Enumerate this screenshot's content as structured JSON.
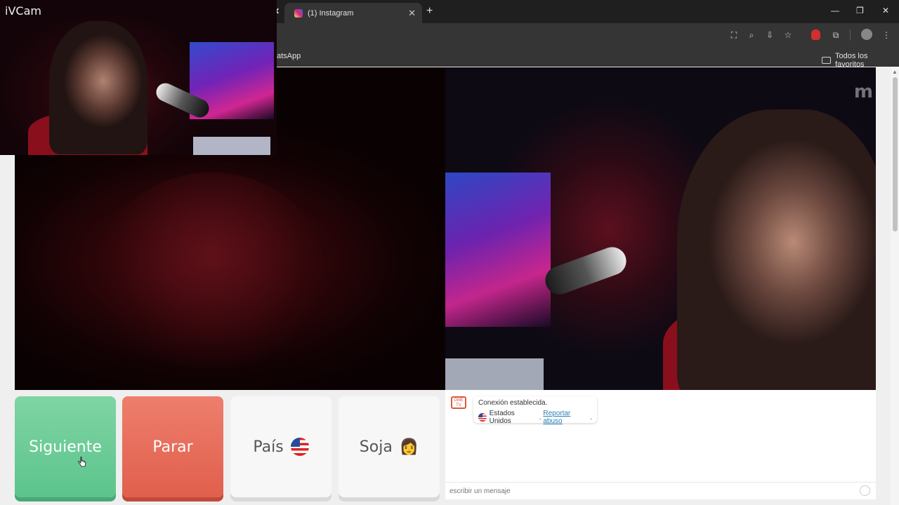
{
  "overlay": {
    "title": "iVCam"
  },
  "browser": {
    "active_tab": {
      "title": "(1) Instagram"
    },
    "tab_close_glyph": "✕",
    "new_tab_glyph": "+",
    "window_controls": {
      "minimize": "—",
      "restore": "❐",
      "close": "✕"
    },
    "bookmarks": {
      "partial_item": "atsApp",
      "all_bookmarks": "Todos los favoritos"
    }
  },
  "actions": {
    "next_label": "Siguiente",
    "stop_label": "Parar",
    "country_label": "País",
    "gender_label": "Soja",
    "gender_emoji": "👩"
  },
  "chat": {
    "logo_text": "OME TV",
    "status": "Conexión establecida.",
    "country": "Estados Unidos",
    "separator": ".",
    "report_link": "Reportar abuso",
    "report_suffix": ".",
    "placeholder": "escribir un mensaje"
  },
  "video": {
    "watermark": "m"
  },
  "colors": {
    "next": "#5cc48c",
    "stop": "#e15f4d",
    "link": "#2a7fb5",
    "logo": "#d95b3b"
  }
}
